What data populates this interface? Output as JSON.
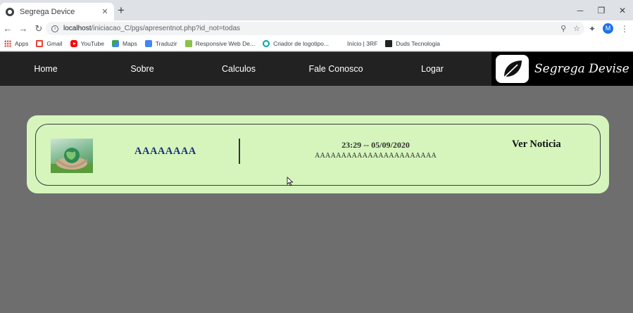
{
  "browser": {
    "tab_title": "Segrega Device",
    "tab_close": "✕",
    "new_tab": "+",
    "url_host": "localhost",
    "url_path": "/iniciacao_C/pgs/apresentnot.php?id_not=todas",
    "profile_initial": "M",
    "window_controls": [
      "─",
      "❐",
      "✕"
    ]
  },
  "bookmarks": [
    {
      "label": "Apps",
      "icon": "apps-grid-icon"
    },
    {
      "label": "Gmail",
      "icon": "gmail-icon"
    },
    {
      "label": "YouTube",
      "icon": "youtube-icon"
    },
    {
      "label": "Maps",
      "icon": "maps-icon"
    },
    {
      "label": "Traduzir",
      "icon": "translate-icon"
    },
    {
      "label": "Responsive Web De...",
      "icon": "rwd-icon"
    },
    {
      "label": "Criador de logotipo...",
      "icon": "logo-maker-icon"
    },
    {
      "label": "Início | 3RF",
      "icon": "blank-icon"
    },
    {
      "label": "Duds Tecnologia",
      "icon": "duds-icon"
    }
  ],
  "site_nav": {
    "links": [
      "Home",
      "Sobre",
      "Calculos",
      "Fale Conosco",
      "Logar"
    ],
    "brand": "Segrega Devise"
  },
  "news": {
    "title": "AAAAAAAA",
    "datetime": "23:29 -- 05/09/2020",
    "description": "AAAAAAAAAAAAAAAAAAAAAAA",
    "link_label": "Ver Noticia"
  },
  "colors": {
    "page_bg": "#6e6e6e",
    "navbar_bg": "#222222",
    "card_bg": "#d6f5bd",
    "title_color": "#1a2f7a"
  }
}
